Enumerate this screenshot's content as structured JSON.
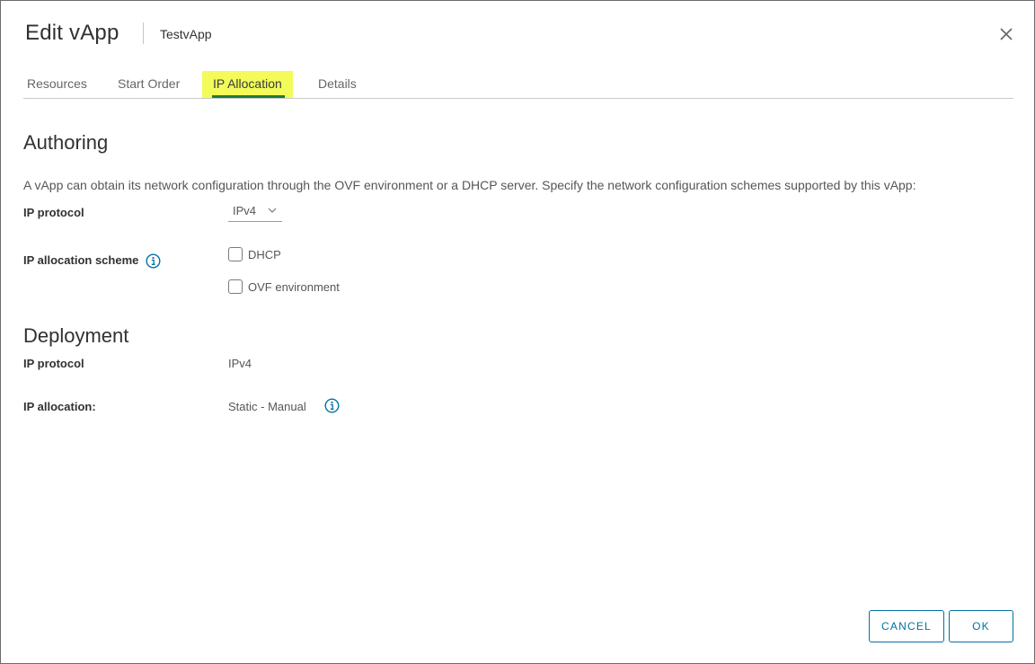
{
  "header": {
    "title": "Edit vApp",
    "subtitle": "TestvApp"
  },
  "tabs": [
    {
      "label": "Resources",
      "active": false
    },
    {
      "label": "Start Order",
      "active": false
    },
    {
      "label": "IP Allocation",
      "active": true
    },
    {
      "label": "Details",
      "active": false
    }
  ],
  "authoring": {
    "title": "Authoring",
    "description": "A vApp can obtain its network configuration through the OVF environment or a DHCP server. Specify the network configuration schemes supported by this vApp:",
    "ip_protocol_label": "IP protocol",
    "ip_protocol_value": "IPv4",
    "scheme_label": "IP allocation scheme",
    "options": [
      {
        "label": "DHCP",
        "checked": false
      },
      {
        "label": "OVF environment",
        "checked": false
      }
    ]
  },
  "deployment": {
    "title": "Deployment",
    "ip_protocol_label": "IP protocol",
    "ip_protocol_value": "IPv4",
    "ip_allocation_label": "IP allocation:",
    "ip_allocation_value": "Static - Manual"
  },
  "footer": {
    "cancel_label": "CANCEL",
    "ok_label": "OK"
  },
  "colors": {
    "accent": "#0072a3",
    "tab_highlight": "#f2fb5a",
    "tab_underline": "#1f7a3a"
  }
}
